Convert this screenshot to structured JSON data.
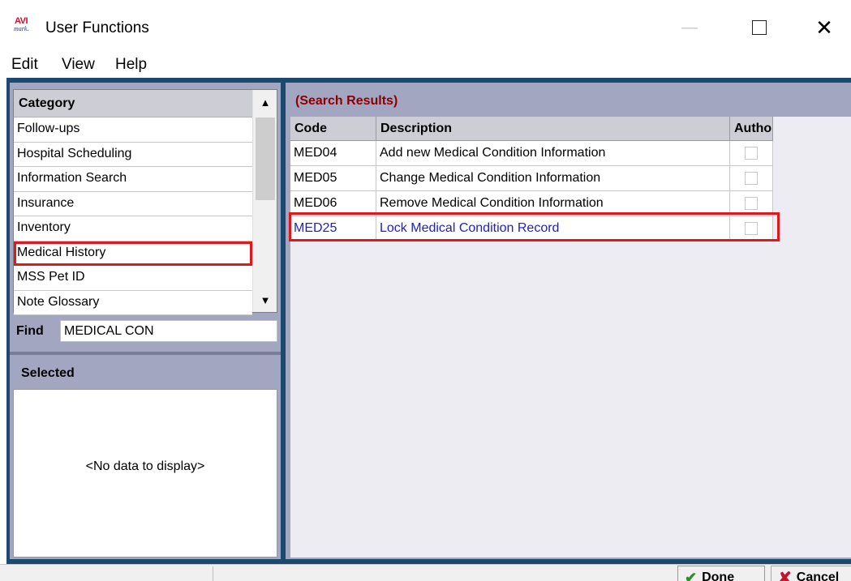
{
  "window": {
    "title": "User Functions",
    "logo_top": "AVI",
    "logo_bottom": "mark."
  },
  "menu": {
    "items": [
      "Edit",
      "View",
      "Help"
    ]
  },
  "category": {
    "header": "Category",
    "items": [
      "Follow-ups",
      "Hospital Scheduling",
      "Information Search",
      "Insurance",
      "Inventory",
      "Medical History",
      "MSS Pet ID",
      "Note Glossary"
    ],
    "selected_index": 5
  },
  "find": {
    "label": "Find",
    "value": "MEDICAL CON"
  },
  "selected": {
    "header": "Selected",
    "empty_text": "<No data to display>"
  },
  "results": {
    "title": "(Search Results)",
    "columns": {
      "code": "Code",
      "description": "Description",
      "auth": "Autho"
    },
    "rows": [
      {
        "code": "MED04",
        "description": "Add new Medical Condition Information"
      },
      {
        "code": "MED05",
        "description": "Change Medical Condition Information"
      },
      {
        "code": "MED06",
        "description": "Remove Medical Condition Information"
      },
      {
        "code": "MED25",
        "description": "Lock Medical Condition Record"
      }
    ]
  },
  "buttons": {
    "done": "Done",
    "cancel": "Cancel"
  },
  "colors": {
    "frame": "#1c4a6e",
    "panel": "#a3a6c0",
    "highlight_outline": "#e0181e",
    "results_title": "#8b0000",
    "selected_row_text": "#1e1ec8"
  }
}
